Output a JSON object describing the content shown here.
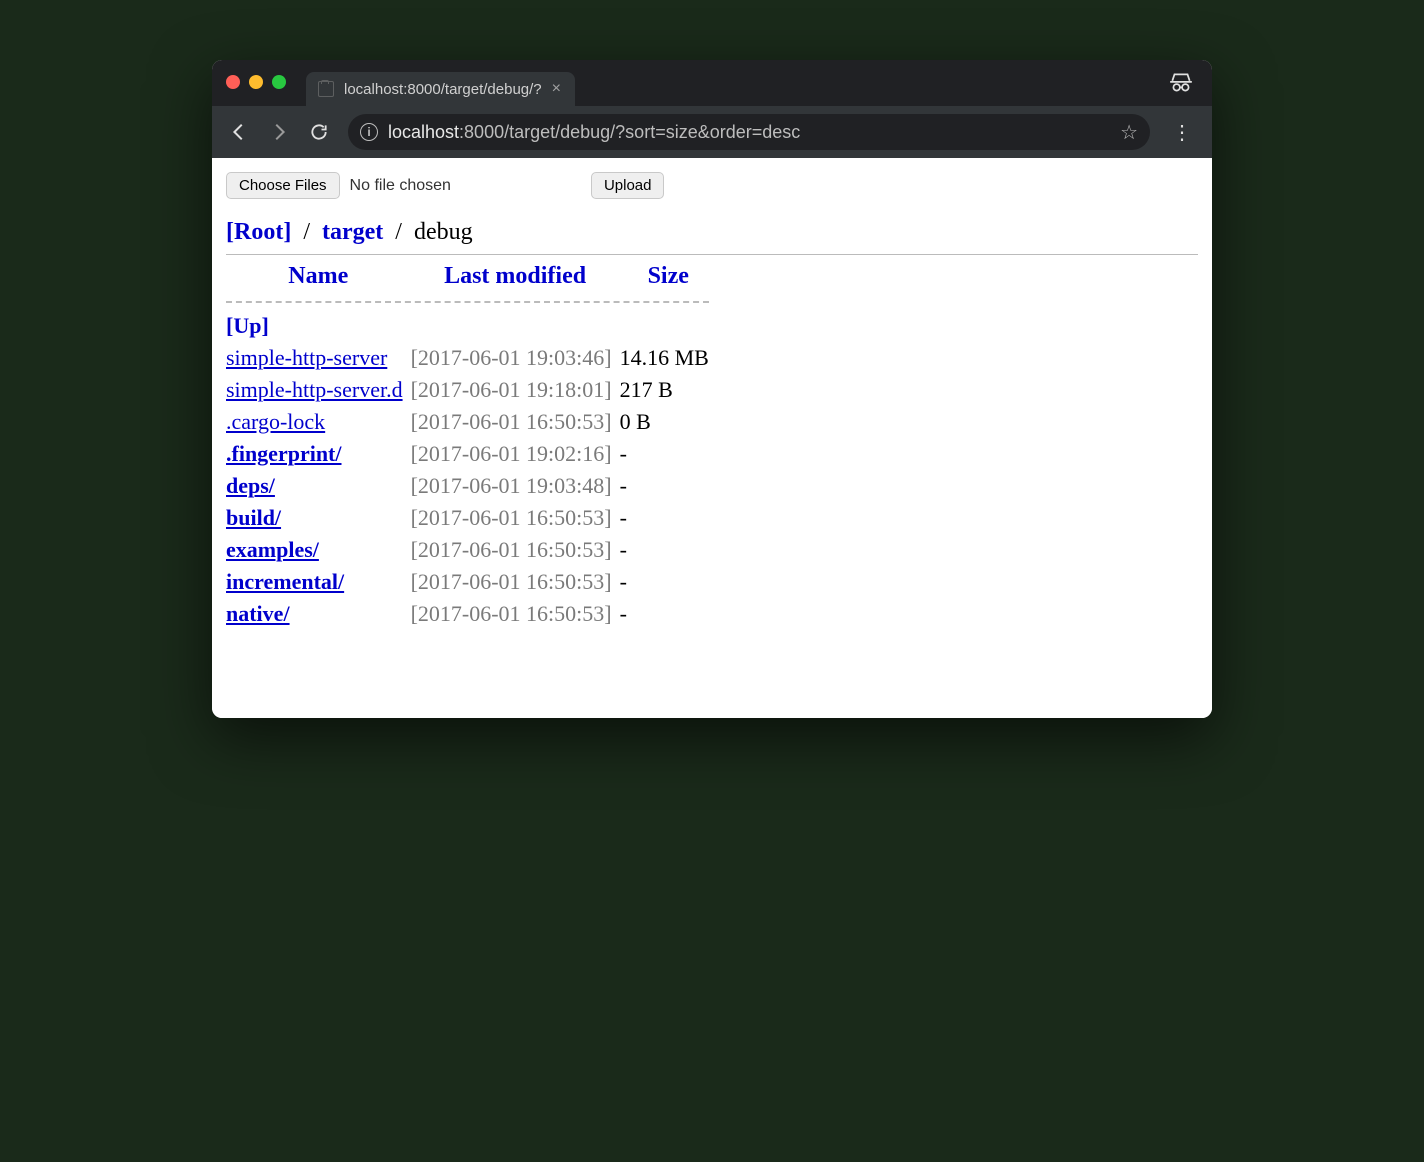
{
  "browser": {
    "tab_title": "localhost:8000/target/debug/?",
    "url_host": "localhost",
    "url_path": ":8000/target/debug/?sort=size&order=desc"
  },
  "upload": {
    "choose_label": "Choose Files",
    "status": "No file chosen",
    "upload_label": "Upload"
  },
  "breadcrumb": {
    "root": "[Root]",
    "target": "target",
    "current": "debug"
  },
  "headers": {
    "name": "Name",
    "modified": "Last modified",
    "size": "Size"
  },
  "up_label": "[Up]",
  "rows": [
    {
      "name": "simple-http-server",
      "type": "file",
      "modified": "[2017-06-01 19:03:46]",
      "size": "14.16 MB"
    },
    {
      "name": "simple-http-server.d",
      "type": "file",
      "modified": "[2017-06-01 19:18:01]",
      "size": "217 B"
    },
    {
      "name": ".cargo-lock",
      "type": "file",
      "modified": "[2017-06-01 16:50:53]",
      "size": "0 B"
    },
    {
      "name": ".fingerprint/",
      "type": "folder",
      "modified": "[2017-06-01 19:02:16]",
      "size": "-"
    },
    {
      "name": "deps/",
      "type": "folder",
      "modified": "[2017-06-01 19:03:48]",
      "size": "-"
    },
    {
      "name": "build/",
      "type": "folder",
      "modified": "[2017-06-01 16:50:53]",
      "size": "-"
    },
    {
      "name": "examples/",
      "type": "folder",
      "modified": "[2017-06-01 16:50:53]",
      "size": "-"
    },
    {
      "name": "incremental/",
      "type": "folder",
      "modified": "[2017-06-01 16:50:53]",
      "size": "-"
    },
    {
      "name": "native/",
      "type": "folder",
      "modified": "[2017-06-01 16:50:53]",
      "size": "-"
    }
  ]
}
